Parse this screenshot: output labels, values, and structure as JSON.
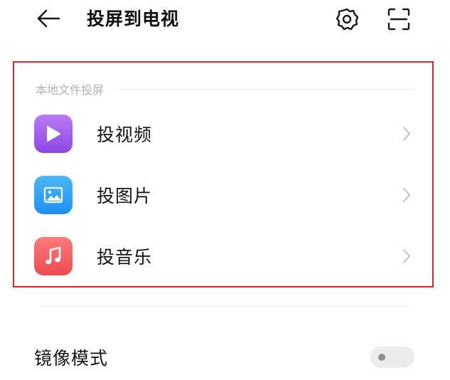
{
  "header": {
    "title": "投屏到电视",
    "back_icon": "arrow-left-icon",
    "settings_icon": "gear-icon",
    "scan_icon": "scan-icon"
  },
  "local_cast": {
    "section_title": "本地文件投屏",
    "items": [
      {
        "label": "投视频",
        "icon": "play-icon",
        "color_top": "#bb7bf6",
        "color_bottom": "#8b47e6"
      },
      {
        "label": "投图片",
        "icon": "image-icon",
        "color_top": "#49b8fb",
        "color_bottom": "#1f8ff2"
      },
      {
        "label": "投音乐",
        "icon": "music-note-icon",
        "color_top": "#fb7b7b",
        "color_bottom": "#ee4b51"
      }
    ]
  },
  "mirror": {
    "label": "镜像模式",
    "enabled": false
  },
  "colors": {
    "highlight_border": "#d8262c",
    "section_title": "#b3b3b3",
    "toggle_off": "#ececec"
  }
}
